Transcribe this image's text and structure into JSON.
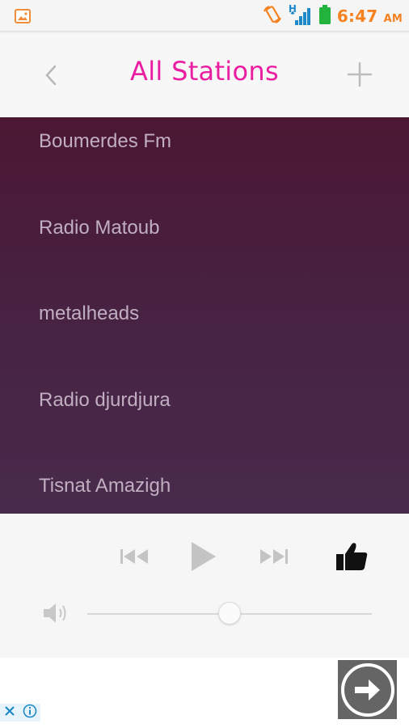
{
  "status_bar": {
    "time": "6:47",
    "ampm": "AM",
    "network_type": "H",
    "icons": [
      "gallery-icon",
      "rotate-icon",
      "signal-icon",
      "battery-icon"
    ]
  },
  "header": {
    "title": "All Stations",
    "back_icon": "chevron-left-icon",
    "add_icon": "plus-icon"
  },
  "stations": [
    {
      "name": "Boumerdes Fm"
    },
    {
      "name": "Radio Matoub"
    },
    {
      "name": "metalheads"
    },
    {
      "name": "Radio djurdjura"
    },
    {
      "name": "Tisnat Amazigh"
    }
  ],
  "player": {
    "controls": [
      "previous-icon",
      "play-icon",
      "next-icon",
      "thumbs-up-icon"
    ],
    "volume_level": 0.5
  },
  "ad": {
    "icons": [
      "close-icon",
      "info-icon",
      "arrow-right-icon"
    ]
  },
  "colors": {
    "accent": "#e91ea0",
    "clock": "#f58220",
    "list_top": "#4b1733",
    "list_bottom": "#482b4c",
    "station_text": "#c1aec0"
  }
}
